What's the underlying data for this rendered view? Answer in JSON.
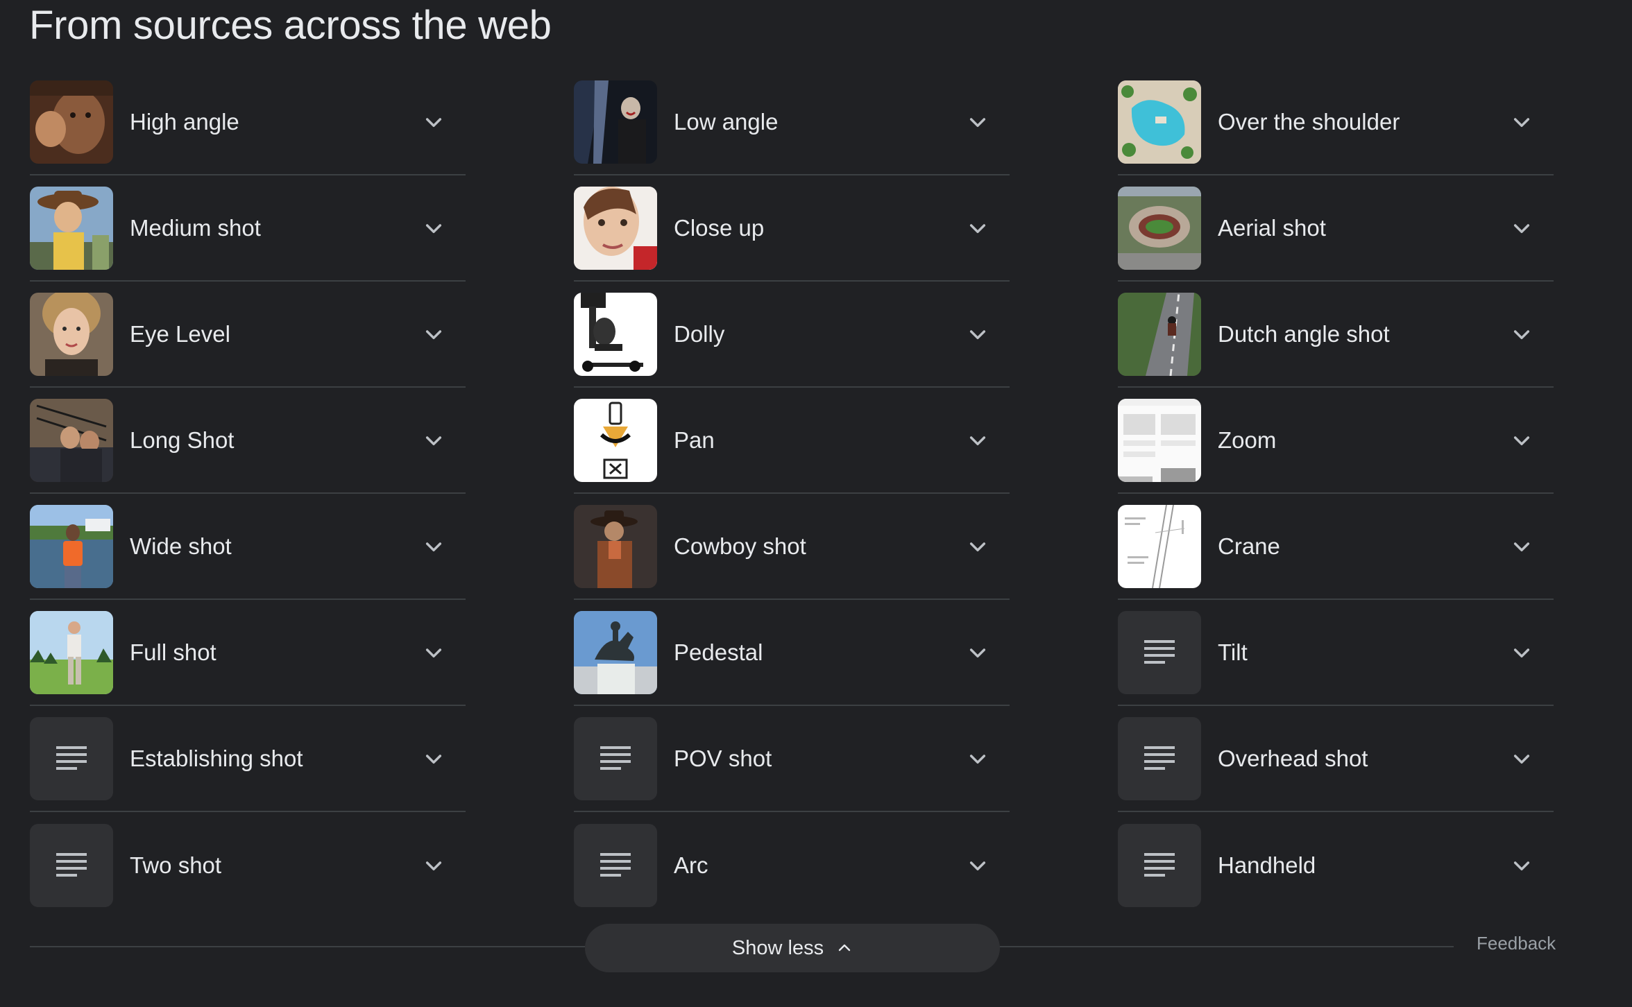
{
  "section_title": "From sources across the web",
  "columns": [
    [
      {
        "label": "High angle",
        "thumb": "photo-man-reaching"
      },
      {
        "label": "Medium shot",
        "thumb": "photo-toy-cowboy"
      },
      {
        "label": "Eye Level",
        "thumb": "photo-woman-portrait"
      },
      {
        "label": "Long Shot",
        "thumb": "photo-couple-ship-bow"
      },
      {
        "label": "Wide shot",
        "thumb": "photo-man-by-lake"
      },
      {
        "label": "Full shot",
        "thumb": "photo-man-in-field"
      },
      {
        "label": "Establishing shot",
        "thumb": "text-lines-icon"
      },
      {
        "label": "Two shot",
        "thumb": "text-lines-icon"
      }
    ],
    [
      {
        "label": "Low angle",
        "thumb": "photo-figure-in-tunnel"
      },
      {
        "label": "Close up",
        "thumb": "photo-face-closeup"
      },
      {
        "label": "Dolly",
        "thumb": "photo-camera-rig"
      },
      {
        "label": "Pan",
        "thumb": "diagram-camera-pan"
      },
      {
        "label": "Cowboy shot",
        "thumb": "photo-cowboy"
      },
      {
        "label": "Pedestal",
        "thumb": "photo-equestrian-statue"
      },
      {
        "label": "POV shot",
        "thumb": "text-lines-icon"
      },
      {
        "label": "Arc",
        "thumb": "text-lines-icon"
      }
    ],
    [
      {
        "label": "Over the shoulder",
        "thumb": "photo-aerial-resort-pool"
      },
      {
        "label": "Aerial shot",
        "thumb": "photo-aerial-stadium"
      },
      {
        "label": "Dutch angle shot",
        "thumb": "photo-motorcycle-road"
      },
      {
        "label": "Zoom",
        "thumb": "screenshot-ui"
      },
      {
        "label": "Crane",
        "thumb": "diagram-sketch"
      },
      {
        "label": "Tilt",
        "thumb": "text-lines-icon"
      },
      {
        "label": "Overhead shot",
        "thumb": "text-lines-icon"
      },
      {
        "label": "Handheld",
        "thumb": "text-lines-icon"
      }
    ]
  ],
  "show_less_label": "Show less",
  "feedback_label": "Feedback",
  "colors": {
    "background": "#202124",
    "divider": "#3c4043",
    "text": "#e8eaed",
    "muted": "#9aa0a6",
    "thumb_placeholder": "#303134"
  }
}
